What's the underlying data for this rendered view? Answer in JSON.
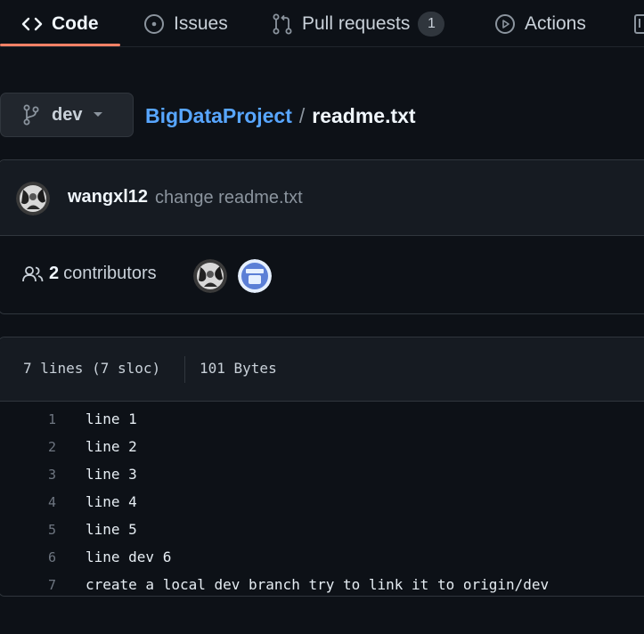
{
  "nav": {
    "tabs": [
      {
        "label": "Code",
        "icon": "code-icon",
        "active": true
      },
      {
        "label": "Issues",
        "icon": "issue-opened-icon"
      },
      {
        "label": "Pull requests",
        "icon": "git-pull-request-icon",
        "count": "1"
      },
      {
        "label": "Actions",
        "icon": "play-icon"
      }
    ],
    "accent": "#f78166"
  },
  "breadcrumb": {
    "branch": "dev",
    "repo": "BigDataProject",
    "separator": "/",
    "file": "readme.txt"
  },
  "commit": {
    "author": "wangxl12",
    "message": "change readme.txt"
  },
  "contributors": {
    "count": "2",
    "label": "contributors"
  },
  "file": {
    "lines_info": "7 lines (7 sloc)",
    "size": "101 Bytes",
    "lines": [
      {
        "num": "1",
        "text": "line 1"
      },
      {
        "num": "2",
        "text": "line 2"
      },
      {
        "num": "3",
        "text": "line 3"
      },
      {
        "num": "4",
        "text": "line 4"
      },
      {
        "num": "5",
        "text": "line 5"
      },
      {
        "num": "6",
        "text": "line dev 6"
      },
      {
        "num": "7",
        "text": "create a local dev branch try to link it to origin/dev"
      }
    ]
  },
  "colors": {
    "background": "#0d1117",
    "panel": "#161b22",
    "border": "#30363d",
    "link": "#58a6ff",
    "muted": "#8b949e"
  }
}
